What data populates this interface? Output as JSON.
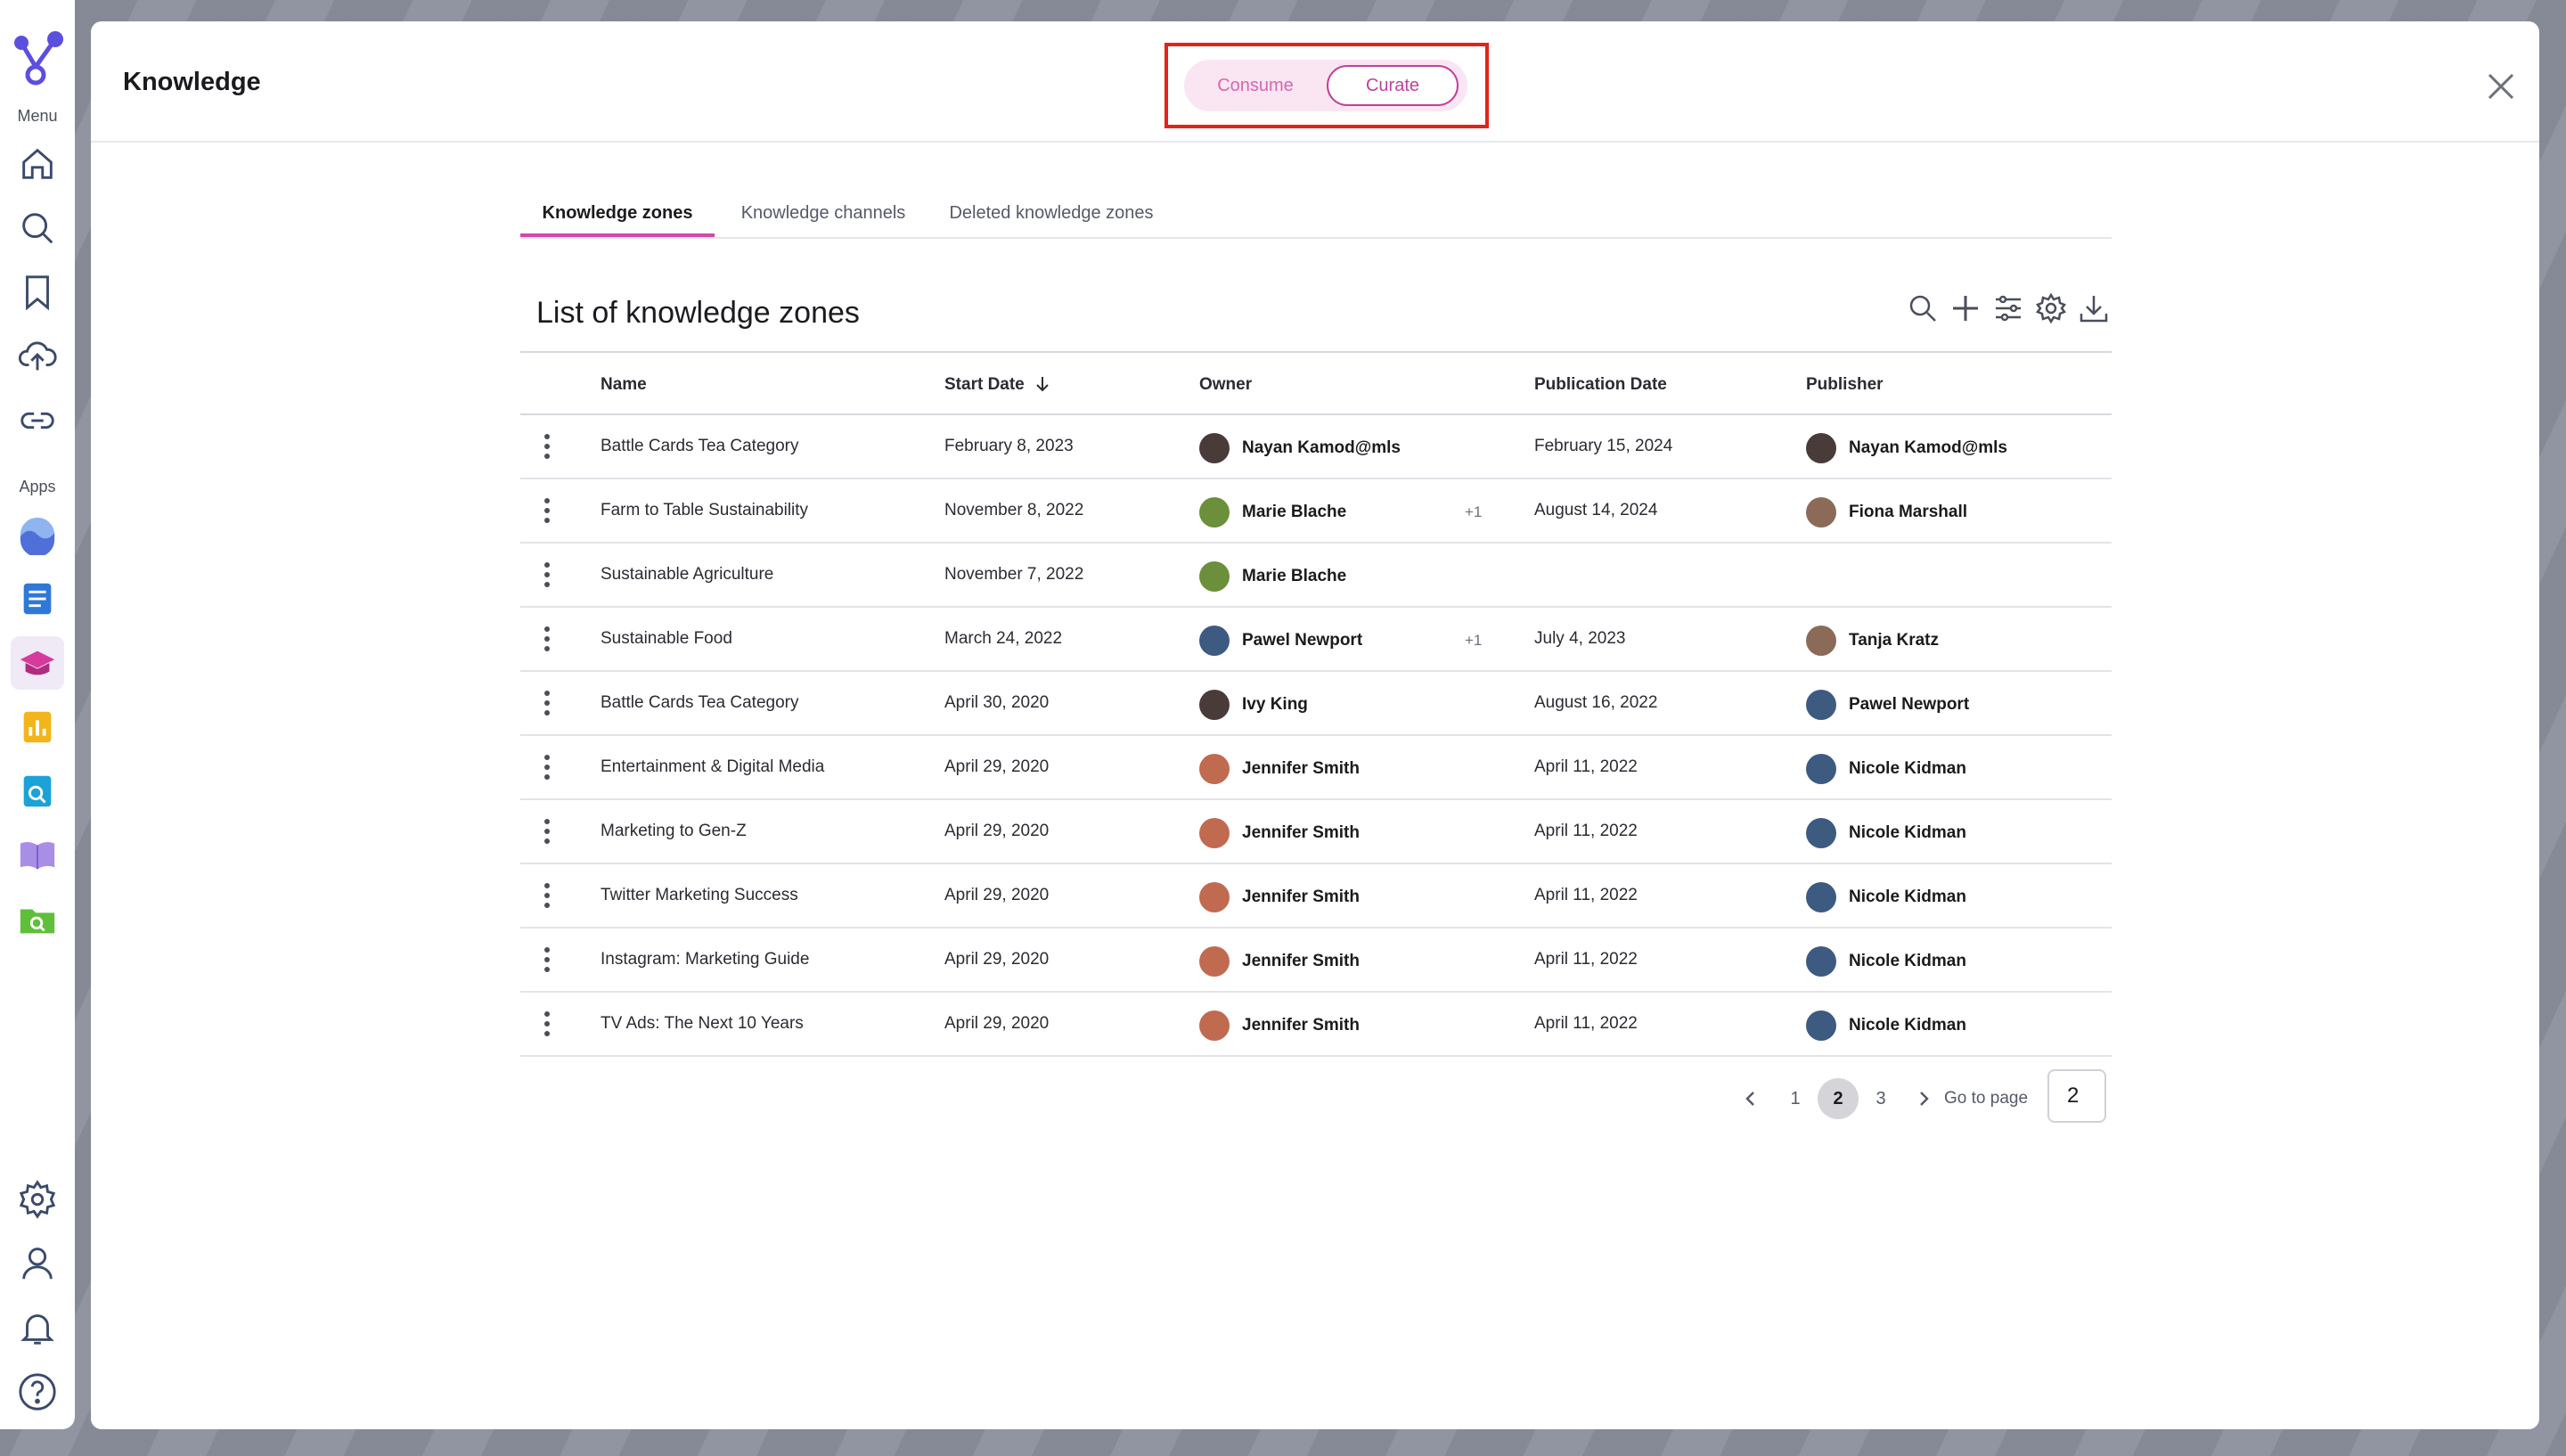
{
  "sidebar": {
    "menu_label": "Menu",
    "apps_label": "Apps",
    "menu_items": [
      {
        "icon": "home-icon"
      },
      {
        "icon": "search-icon"
      },
      {
        "icon": "bookmark-icon"
      },
      {
        "icon": "upload-cloud-icon"
      },
      {
        "icon": "link-icon"
      }
    ],
    "apps": [
      {
        "icon": "app-wave-icon",
        "color": "#4f6fd9"
      },
      {
        "icon": "app-document-icon",
        "color": "#2f78d8"
      },
      {
        "icon": "app-knowledge-icon",
        "color": "#d63a9c"
      },
      {
        "icon": "app-chart-icon",
        "color": "#f2b51b"
      },
      {
        "icon": "app-search-doc-icon",
        "color": "#1ba3d6"
      },
      {
        "icon": "app-book-icon",
        "color": "#8f6fe0"
      },
      {
        "icon": "app-folder-search-icon",
        "color": "#5fbf3a"
      }
    ],
    "bottom_items": [
      {
        "icon": "settings-icon"
      },
      {
        "icon": "profile-icon"
      },
      {
        "icon": "bell-icon"
      },
      {
        "icon": "help-icon"
      }
    ]
  },
  "header": {
    "title": "Knowledge",
    "toggle": {
      "consume": "Consume",
      "curate": "Curate",
      "active": "Curate"
    }
  },
  "tabs": [
    {
      "label": "Knowledge zones",
      "active": true
    },
    {
      "label": "Knowledge channels",
      "active": false
    },
    {
      "label": "Deleted knowledge zones",
      "active": false
    }
  ],
  "list_title": "List of knowledge zones",
  "columns": {
    "name": "Name",
    "start_date": "Start Date",
    "owner": "Owner",
    "publication_date": "Publication Date",
    "publisher": "Publisher"
  },
  "rows": [
    {
      "name": "Battle Cards Tea Category",
      "start": "February 8, 2023",
      "owner": "Nayan Kamod@mls",
      "owner_extra": "",
      "pub_date": "February 15, 2024",
      "publisher": "Nayan Kamod@mls"
    },
    {
      "name": "Farm to Table Sustainability",
      "start": "November 8, 2022",
      "owner": "Marie Blache",
      "owner_extra": "+1",
      "pub_date": "August 14, 2024",
      "publisher": "Fiona Marshall"
    },
    {
      "name": "Sustainable Agriculture",
      "start": "November 7, 2022",
      "owner": "Marie Blache",
      "owner_extra": "",
      "pub_date": "",
      "publisher": ""
    },
    {
      "name": "Sustainable Food",
      "start": "March 24, 2022",
      "owner": "Pawel Newport",
      "owner_extra": "+1",
      "pub_date": "July 4, 2023",
      "publisher": "Tanja Kratz"
    },
    {
      "name": "Battle Cards Tea Category",
      "start": "April 30, 2020",
      "owner": "Ivy King",
      "owner_extra": "",
      "pub_date": "August 16, 2022",
      "publisher": "Pawel Newport"
    },
    {
      "name": "Entertainment & Digital Media",
      "start": "April 29, 2020",
      "owner": "Jennifer Smith",
      "owner_extra": "",
      "pub_date": "April 11, 2022",
      "publisher": "Nicole Kidman"
    },
    {
      "name": "Marketing to Gen-Z",
      "start": "April 29, 2020",
      "owner": "Jennifer Smith",
      "owner_extra": "",
      "pub_date": "April 11, 2022",
      "publisher": "Nicole Kidman"
    },
    {
      "name": "Twitter Marketing Success",
      "start": "April 29, 2020",
      "owner": "Jennifer Smith",
      "owner_extra": "",
      "pub_date": "April 11, 2022",
      "publisher": "Nicole Kidman"
    },
    {
      "name": "Instagram: Marketing Guide",
      "start": "April 29, 2020",
      "owner": "Jennifer Smith",
      "owner_extra": "",
      "pub_date": "April 11, 2022",
      "publisher": "Nicole Kidman"
    },
    {
      "name": "TV Ads: The Next 10 Years",
      "start": "April 29, 2020",
      "owner": "Jennifer Smith",
      "owner_extra": "",
      "pub_date": "April 11, 2022",
      "publisher": "Nicole Kidman"
    }
  ],
  "pagination": {
    "pages": [
      "1",
      "2",
      "3"
    ],
    "current": "2",
    "goto_label": "Go to page",
    "goto_value": "2"
  },
  "colors": {
    "accent": "#c2409a",
    "highlight_box": "#e2231a",
    "avatar_palette": [
      "#3d5a80",
      "#6b8f3a",
      "#8c6a58",
      "#4a3b3b",
      "#c06a50"
    ]
  }
}
